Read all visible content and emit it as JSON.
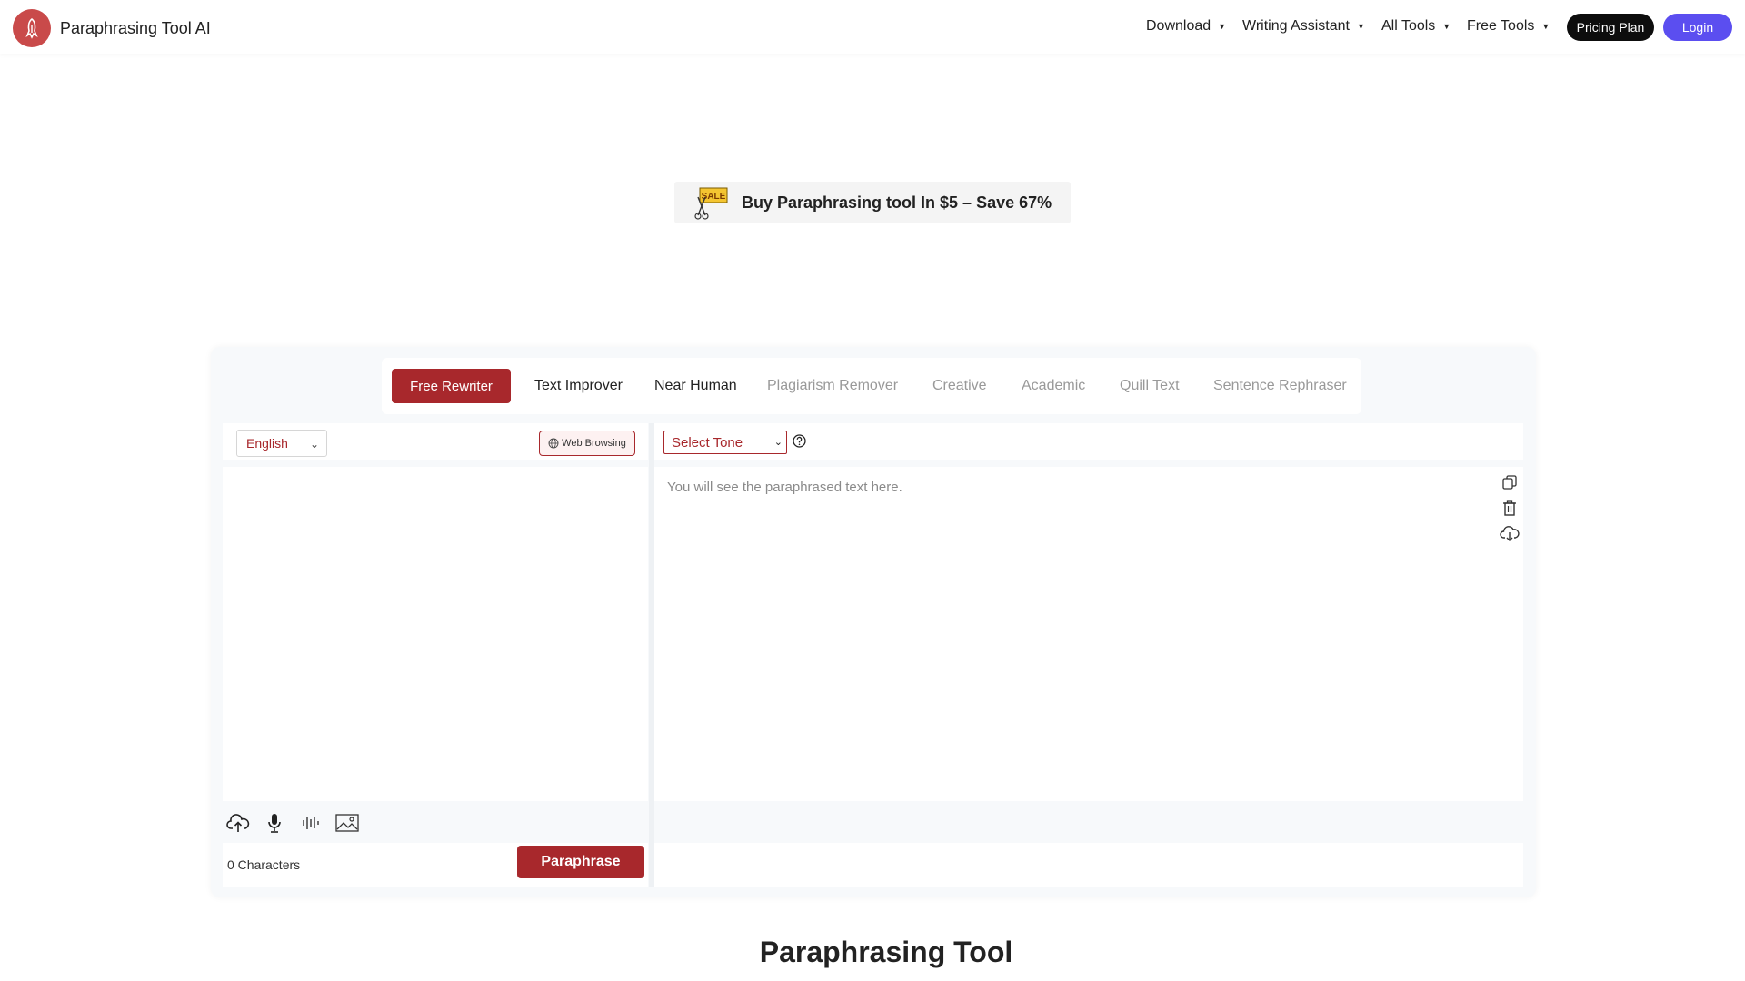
{
  "header": {
    "brand_name": "Paraphrasing Tool AI",
    "nav": [
      {
        "label": "Download"
      },
      {
        "label": "Writing Assistant"
      },
      {
        "label": "All Tools"
      },
      {
        "label": "Free Tools"
      }
    ],
    "pricing_label": "Pricing Plan",
    "login_label": "Login"
  },
  "promo": {
    "icon": "sale-tag-icon",
    "text": "Buy Paraphrasing tool In $5 – Save 67%"
  },
  "tabs": [
    {
      "label": "Free Rewriter",
      "active": true
    },
    {
      "label": "Text Improver"
    },
    {
      "label": "Near Human"
    },
    {
      "label": "Plagiarism Remover"
    },
    {
      "label": "Creative"
    },
    {
      "label": "Academic"
    },
    {
      "label": "Quill Text"
    },
    {
      "label": "Sentence Rephraser"
    }
  ],
  "input": {
    "language": "English",
    "web_browsing_label": "Web Browsing",
    "characters": "0 Characters",
    "paraphrase_label": "Paraphrase",
    "tool_icons": [
      "upload-cloud-icon",
      "microphone-icon",
      "audio-wave-icon",
      "image-icon"
    ]
  },
  "output": {
    "tone_label": "Select Tone",
    "placeholder": "You will see the paraphrased text here.",
    "icons": [
      "copy-icon",
      "trash-icon",
      "download-icon"
    ]
  },
  "page": {
    "heading": "Paraphrasing Tool"
  },
  "colors": {
    "accent": "#a8282c",
    "login": "#5b4ef0",
    "logo": "#c94a4a"
  }
}
